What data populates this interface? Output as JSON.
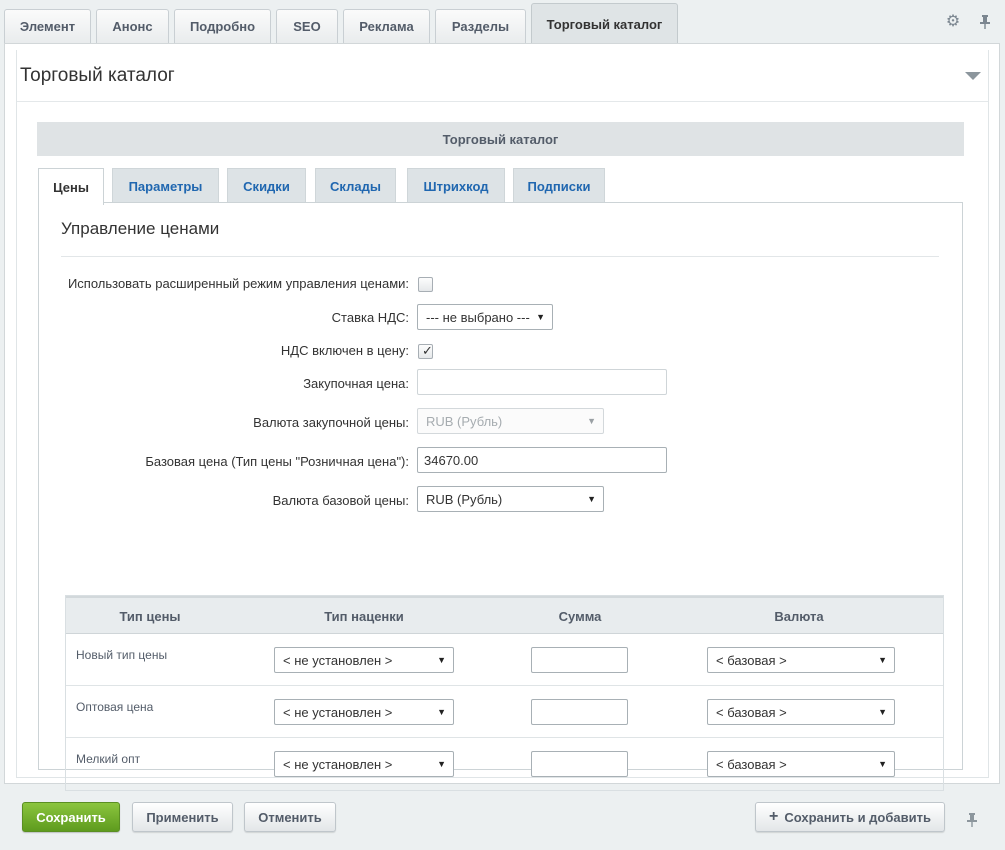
{
  "top_tabs": [
    {
      "label": "Элемент"
    },
    {
      "label": "Анонс"
    },
    {
      "label": "Подробно"
    },
    {
      "label": "SEO"
    },
    {
      "label": "Реклама"
    },
    {
      "label": "Разделы"
    },
    {
      "label": "Торговый каталог",
      "active": true
    }
  ],
  "top_icons": {
    "settings": "gear-icon",
    "pin": "pin-icon"
  },
  "panel": {
    "title": "Торговый каталог",
    "section_header": "Торговый каталог"
  },
  "sub_tabs": [
    {
      "label": "Цены",
      "active": true
    },
    {
      "label": "Параметры"
    },
    {
      "label": "Скидки"
    },
    {
      "label": "Склады"
    },
    {
      "label": "Штрихкод"
    },
    {
      "label": "Подписки"
    }
  ],
  "prices": {
    "title": "Управление ценами",
    "extended_mode_label": "Использовать расширенный режим управления ценами:",
    "extended_mode_checked": false,
    "vat_rate_label": "Ставка НДС:",
    "vat_rate_value": "--- не выбрано ---",
    "vat_included_label": "НДС включен в цену:",
    "vat_included_checked": true,
    "purchase_price_label": "Закупочная цена:",
    "purchase_price_value": "",
    "purchase_currency_label": "Валюта закупочной цены:",
    "purchase_currency_value": "RUB (Рубль)",
    "base_price_label": "Базовая цена (Тип цены \"Розничная цена\"):",
    "base_price_value": "34670.00",
    "base_currency_label": "Валюта базовой цены:",
    "base_currency_value": "RUB (Рубль)"
  },
  "price_table": {
    "headers": [
      "Тип цены",
      "Тип наценки",
      "Сумма",
      "Валюта"
    ],
    "rows": [
      {
        "name": "Новый тип цены",
        "markup": "< не установлен >",
        "sum": "",
        "currency": "< базовая >"
      },
      {
        "name": "Оптовая цена",
        "markup": "< не установлен >",
        "sum": "",
        "currency": "< базовая >"
      },
      {
        "name": "Мелкий опт",
        "markup": "< не установлен >",
        "sum": "",
        "currency": "< базовая >"
      }
    ]
  },
  "footer": {
    "save": "Сохранить",
    "apply": "Применить",
    "cancel": "Отменить",
    "save_add": "Сохранить и добавить"
  },
  "colors": {
    "accent_green": "#6aa82a",
    "link_blue": "#2067b0",
    "label_gray": "#535c69"
  }
}
